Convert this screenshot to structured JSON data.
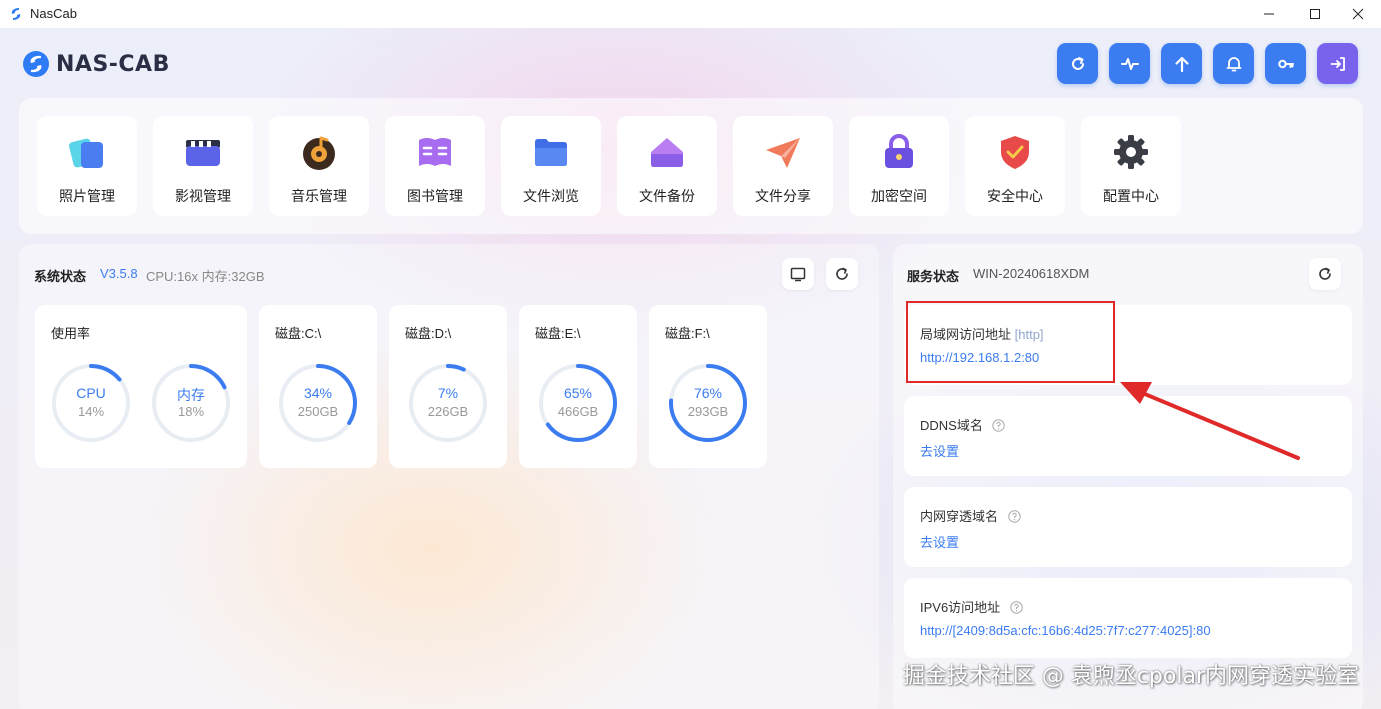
{
  "window": {
    "title": "NasCab",
    "controls": [
      "minimize-icon",
      "maximize-icon",
      "close-icon"
    ]
  },
  "header": {
    "logo_text": "NAS-CAB",
    "actions": [
      {
        "name": "refresh",
        "icon": "refresh-icon"
      },
      {
        "name": "activity",
        "icon": "pulse-icon"
      },
      {
        "name": "upload",
        "icon": "arrow-up-icon"
      },
      {
        "name": "notifications",
        "icon": "bell-icon"
      },
      {
        "name": "key",
        "icon": "key-icon"
      },
      {
        "name": "logout",
        "icon": "logout-icon"
      }
    ]
  },
  "features": [
    {
      "label": "照片管理",
      "icon": "photos-icon"
    },
    {
      "label": "影视管理",
      "icon": "video-icon"
    },
    {
      "label": "音乐管理",
      "icon": "music-icon"
    },
    {
      "label": "图书管理",
      "icon": "book-icon"
    },
    {
      "label": "文件浏览",
      "icon": "folder-icon"
    },
    {
      "label": "文件备份",
      "icon": "backup-icon"
    },
    {
      "label": "文件分享",
      "icon": "paper-plane-icon"
    },
    {
      "label": "加密空间",
      "icon": "lock-icon"
    },
    {
      "label": "安全中心",
      "icon": "shield-icon"
    },
    {
      "label": "配置中心",
      "icon": "gear-icon"
    }
  ],
  "system": {
    "title": "系统状态",
    "version": "V3.5.8",
    "meta": "CPU:16x 内存:32GB",
    "usage": {
      "label": "使用率",
      "cpu": {
        "name": "CPU",
        "value": "14%",
        "fraction": 0.14
      },
      "mem": {
        "name": "内存",
        "value": "18%",
        "fraction": 0.18
      }
    },
    "disks": [
      {
        "label": "磁盘:C:\\",
        "percent": "34%",
        "size": "250GB",
        "fraction": 0.34
      },
      {
        "label": "磁盘:D:\\",
        "percent": "7%",
        "size": "226GB",
        "fraction": 0.07
      },
      {
        "label": "磁盘:E:\\",
        "percent": "65%",
        "size": "466GB",
        "fraction": 0.65
      },
      {
        "label": "磁盘:F:\\",
        "percent": "76%",
        "size": "293GB",
        "fraction": 0.76
      }
    ]
  },
  "service": {
    "title": "服务状态",
    "host": "WIN-20240618XDM",
    "items": [
      {
        "label": "局域网访问地址",
        "tag": "[http]",
        "link": "http://192.168.1.2:80"
      },
      {
        "label": "DDNS域名",
        "link": "去设置"
      },
      {
        "label": "内网穿透域名",
        "link": "去设置"
      },
      {
        "label": "IPV6访问地址",
        "link": "http://[2409:8d5a:cfc:16b6:4d25:7f7:c277:4025]:80"
      }
    ]
  },
  "watermark": "掘金技术社区 @ 袁煦丞cpolar内网穿透实验室",
  "colors": {
    "accent": "#3b7cf0",
    "accent_purple": "#7a63ec",
    "track": "#e8edf3",
    "annotation": "#e02a2a"
  }
}
